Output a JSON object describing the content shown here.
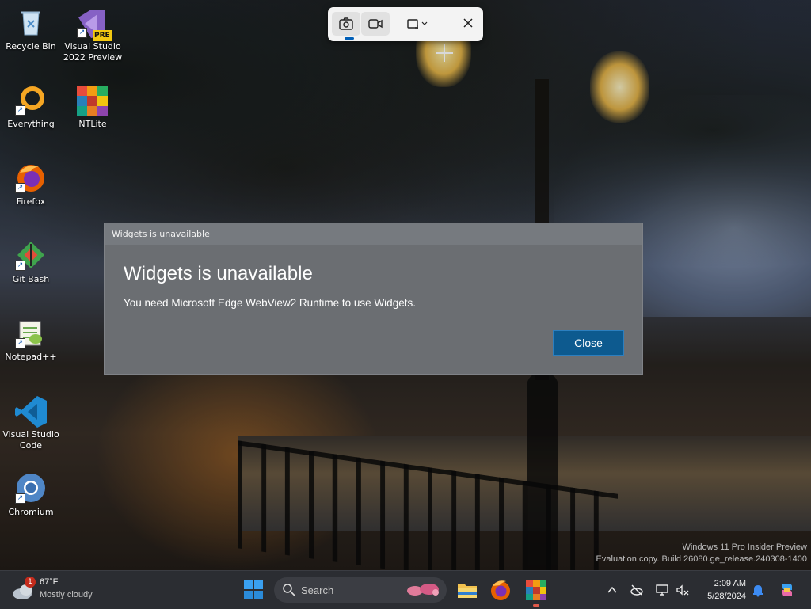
{
  "desktop": {
    "icons": [
      {
        "label": "Recycle Bin"
      },
      {
        "label": "Visual Studio\n2022 Preview",
        "badge": "PRE"
      },
      {
        "label": "Everything"
      },
      {
        "label": "NTLite"
      },
      {
        "label": "Firefox"
      },
      {
        "label": "Git Bash"
      },
      {
        "label": "Notepad++"
      },
      {
        "label": "Visual Studio\nCode"
      },
      {
        "label": "Chromium"
      }
    ]
  },
  "snipping_toolbar": {
    "modes": [
      "camera-icon",
      "video-icon",
      "snip-mode-icon"
    ],
    "selected_mode": "camera-icon"
  },
  "dialog": {
    "window_title": "Widgets is unavailable",
    "heading": "Widgets is unavailable",
    "message": "You need Microsoft Edge WebView2 Runtime to use Widgets.",
    "close_label": "Close",
    "accent_color": "#0d5a8f"
  },
  "watermark": {
    "line1": "Windows 11 Pro Insider Preview",
    "line2": "Evaluation copy. Build 26080.ge_release.240308-1400"
  },
  "taskbar": {
    "weather": {
      "temp": "67°F",
      "condition": "Mostly cloudy",
      "badge": "1"
    },
    "search_placeholder": "Search",
    "pinned": [
      "explorer-icon",
      "firefox-icon",
      "ntlite-icon"
    ],
    "clock": {
      "time": "2:09 AM",
      "date": "5/28/2024"
    }
  }
}
